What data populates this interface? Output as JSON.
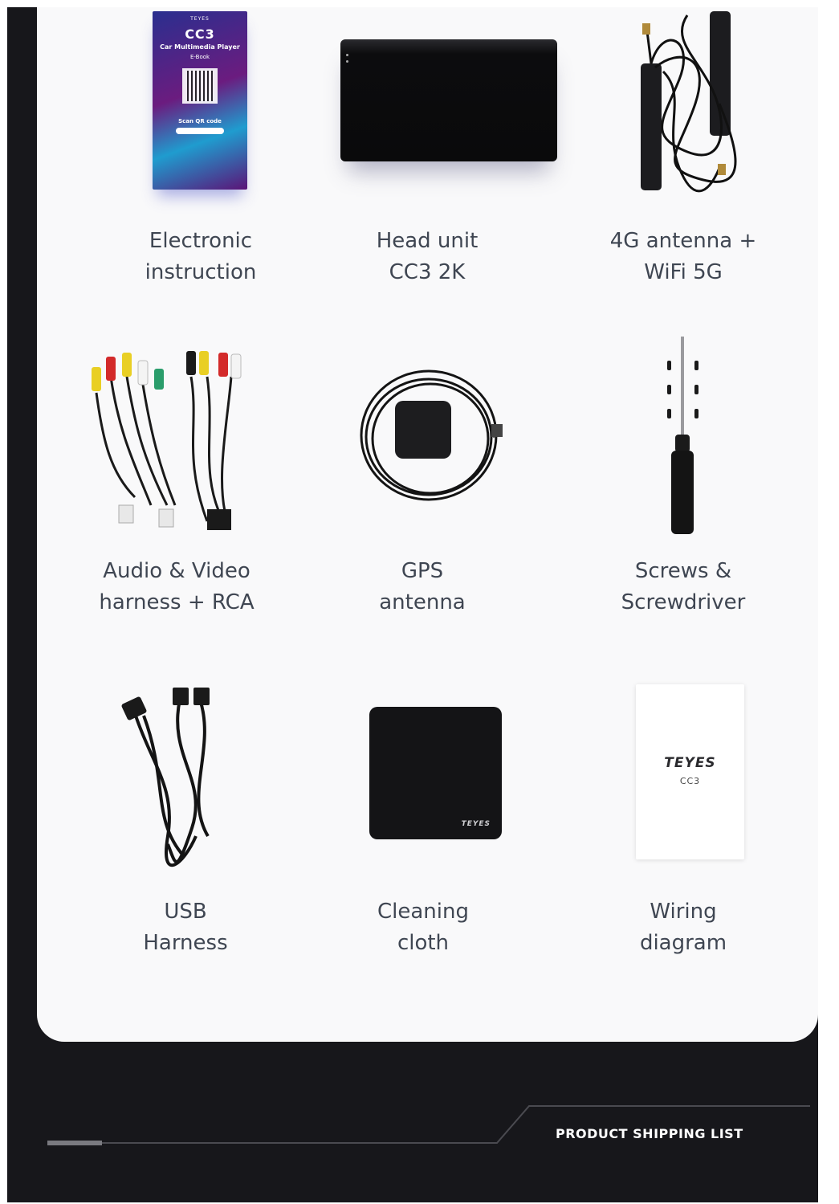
{
  "items": [
    {
      "line1": "Electronic",
      "line2": "instruction"
    },
    {
      "line1": "Head unit",
      "line2": "CC3 2K"
    },
    {
      "line1": "4G antenna +",
      "line2": "WiFi 5G"
    },
    {
      "line1": "Audio & Video",
      "line2": "harness + RCA"
    },
    {
      "line1": "GPS",
      "line2": "antenna"
    },
    {
      "line1": "Screws &",
      "line2": "Screwdriver"
    },
    {
      "line1": "USB",
      "line2": "Harness"
    },
    {
      "line1": "Cleaning",
      "line2": "cloth"
    },
    {
      "line1": "Wiring",
      "line2": "diagram"
    }
  ],
  "booklet": {
    "brand": "TEYES",
    "model": "CC3",
    "subtitle": "Car Multimedia Player",
    "edition": "E-Book",
    "scan": "Scan QR code"
  },
  "cloth": {
    "logo": "TEYES"
  },
  "wiring_card": {
    "logo": "TEYES",
    "model": "CC3"
  },
  "footer": {
    "title": "PRODUCT SHIPPING LIST"
  },
  "colors": {
    "background": "#17171b",
    "card": "#f9f9fa",
    "label": "#3f4652"
  }
}
